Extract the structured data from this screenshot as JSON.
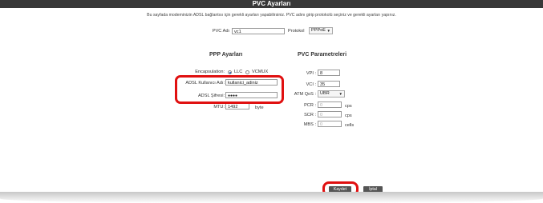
{
  "title": "PVC Ayarları",
  "info_text": "Bu sayfada modeminizin ADSL bağlantısı için gerekli ayarları yapabilirsiniz. PVC adını girip protokolü seçiniz ve gerekli ayarları yapınız.",
  "pvc": {
    "name_label": "PVC Adı",
    "name_value": "vc1",
    "protocol_label": "Protokol",
    "protocol_value": "PPPoE"
  },
  "ppp": {
    "heading": "PPP Ayarları",
    "encapsulation_label": "Encapsulation:",
    "enc_llc": "LLC",
    "enc_vcmux": "VCMUX",
    "enc_selected": "LLC",
    "user_label": "ADSL Kullanıcı Adı:",
    "user_value": "kullanici_adiniz",
    "pass_label": "ADSL Şifresi:",
    "pass_value": "●●●●",
    "mtu_label": "MTU:",
    "mtu_value": "1492",
    "mtu_unit": "byte"
  },
  "pvc_params": {
    "heading": "PVC Parametreleri",
    "vpi_label": "VPI :",
    "vpi_value": "8",
    "vci_label": "VCI :",
    "vci_value": "35",
    "qos_label": "ATM QoS :",
    "qos_value": "UBR",
    "pcr_label": "PCR :",
    "pcr_value": "0",
    "pcr_unit": "cps",
    "scr_label": "SCR :",
    "scr_value": "0",
    "scr_unit": "cps",
    "mbs_label": "MBS :",
    "mbs_value": "0",
    "mbs_unit": "cells"
  },
  "buttons": {
    "save": "Kaydet",
    "cancel": "İptal"
  },
  "colors": {
    "title_bar": "#383838",
    "highlight": "#e01010"
  }
}
